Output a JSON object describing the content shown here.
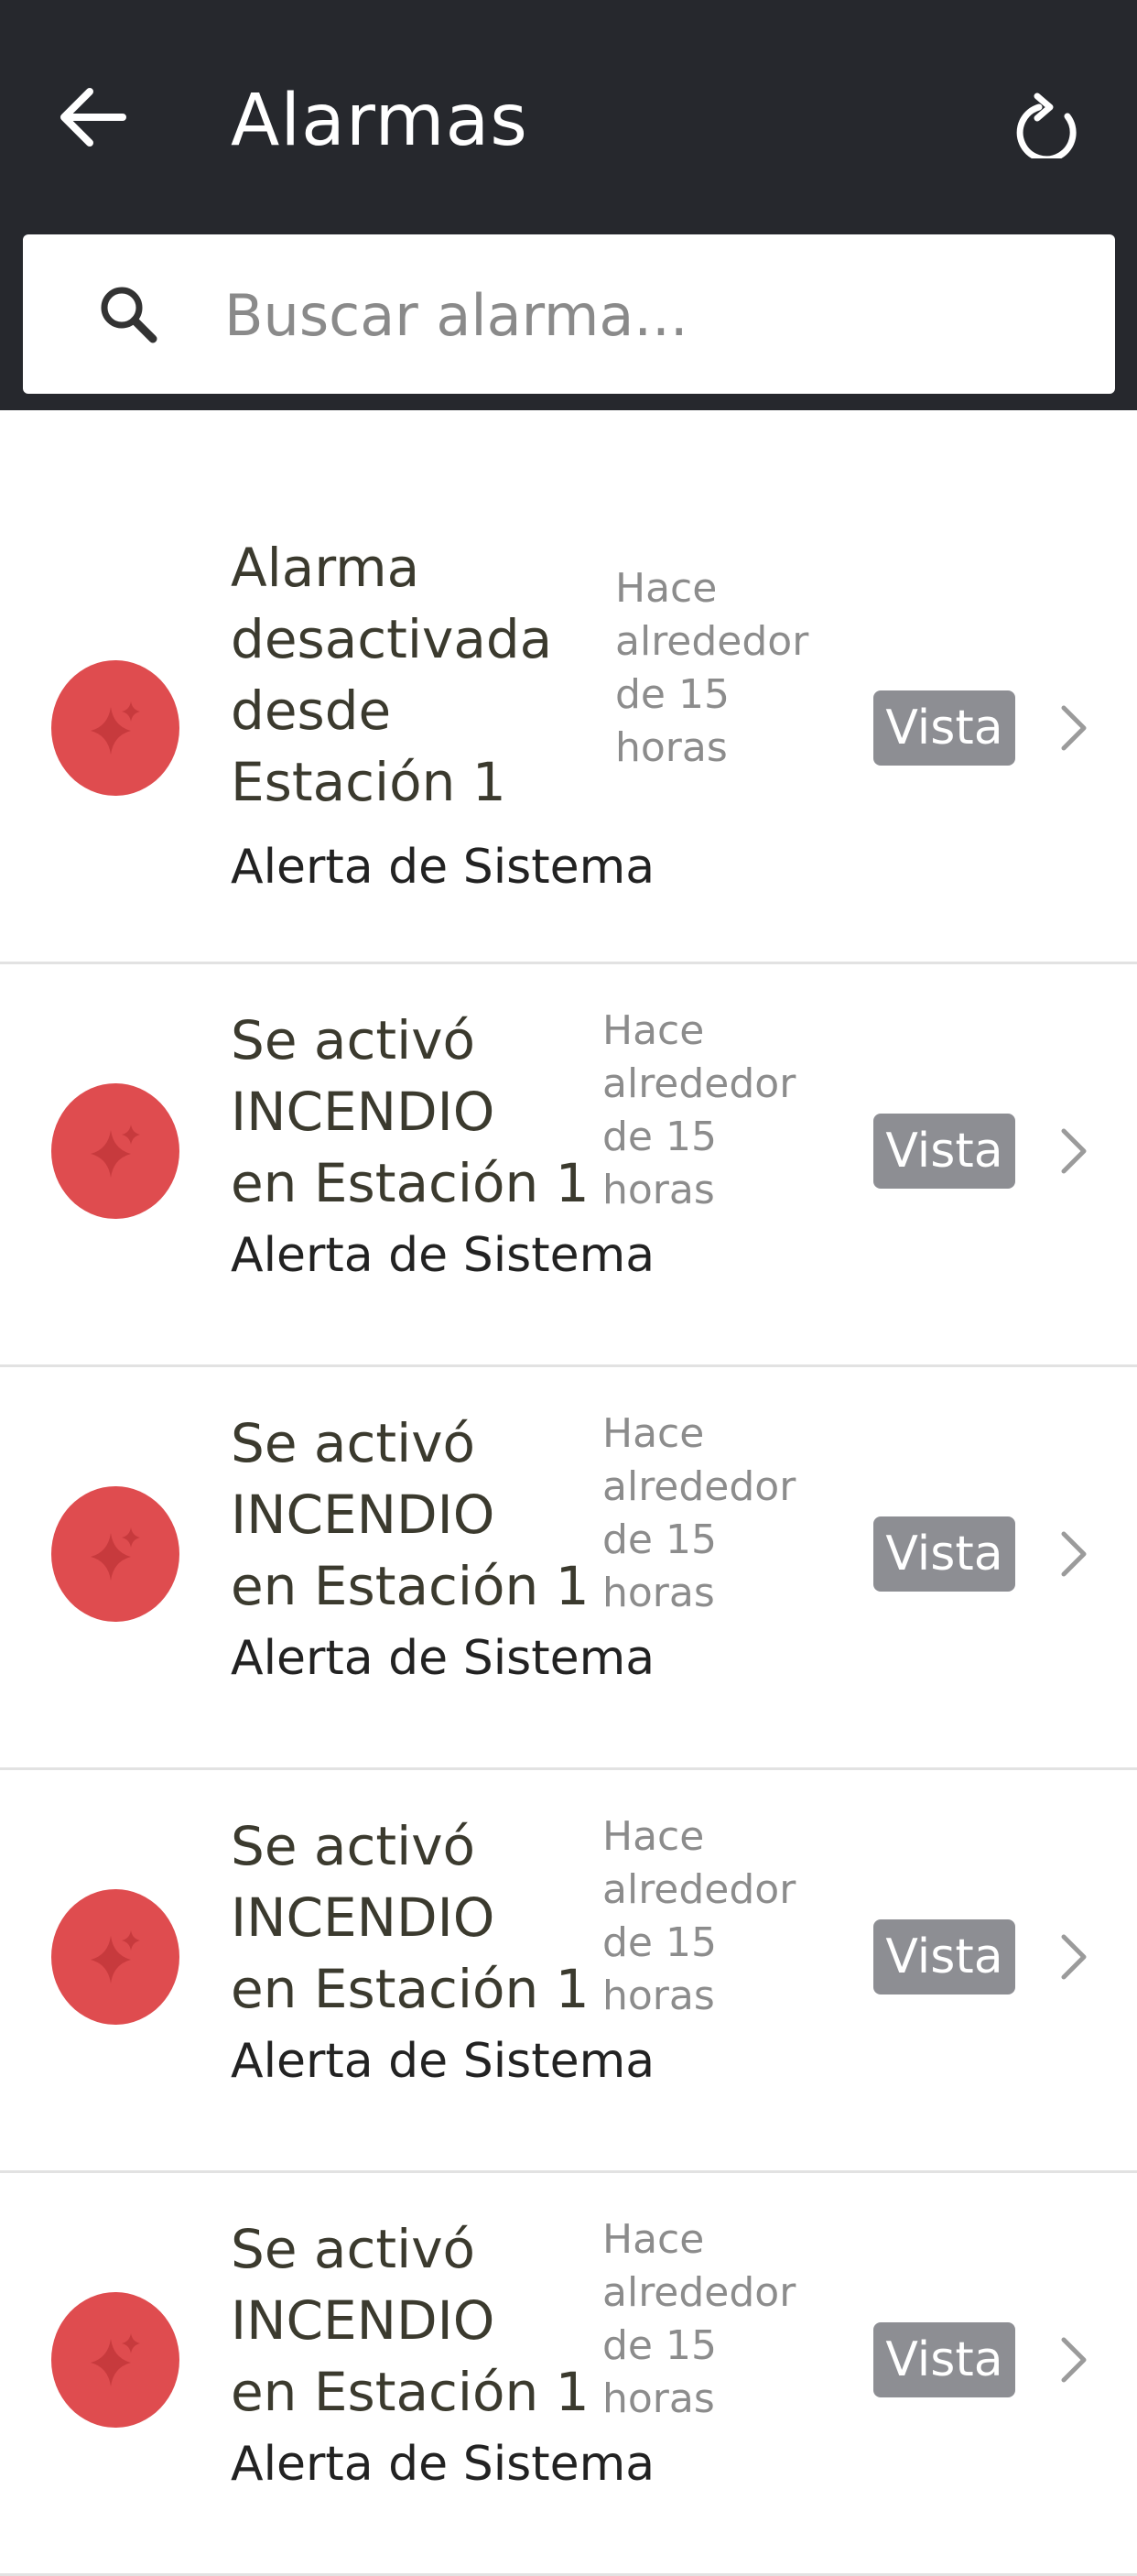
{
  "header": {
    "title": "Alarmas",
    "back_icon": "arrow-left-icon",
    "refresh_icon": "refresh-icon",
    "background": "#26282d"
  },
  "search": {
    "placeholder": "Buscar alarma...",
    "value": "",
    "icon": "search-icon"
  },
  "alarms": [
    {
      "title": "Alarma\ndesactivada\ndesde\nEstación 1",
      "subtitle": "Alerta de Sistema",
      "time": "Hace\nalrededor\nde 15\nhoras",
      "badge": "Vista"
    },
    {
      "title": "Se activó\nINCENDIO\nen Estación 1",
      "subtitle": "Alerta de Sistema",
      "time": "Hace\nalrededor\nde 15\nhoras",
      "badge": "Vista"
    },
    {
      "title": "Se activó\nINCENDIO\nen Estación 1",
      "subtitle": "Alerta de Sistema",
      "time": "Hace\nalrededor\nde 15\nhoras",
      "badge": "Vista"
    },
    {
      "title": "Se activó\nINCENDIO\nen Estación 1",
      "subtitle": "Alerta de Sistema",
      "time": "Hace\nalrededor\nde 15\nhoras",
      "badge": "Vista"
    },
    {
      "title": "Se activó\nINCENDIO\nen Estación 1",
      "subtitle": "Alerta de Sistema",
      "time": "Hace\nalrededor\nde 15\nhoras",
      "badge": "Vista"
    }
  ],
  "colors": {
    "alarm_icon_bg": "#df4c4f",
    "badge_bg": "#8d8e93",
    "divider": "#e2e2e2"
  },
  "alarm_icon": "sparkle-icon",
  "row_chevron_icon": "chevron-right-icon"
}
